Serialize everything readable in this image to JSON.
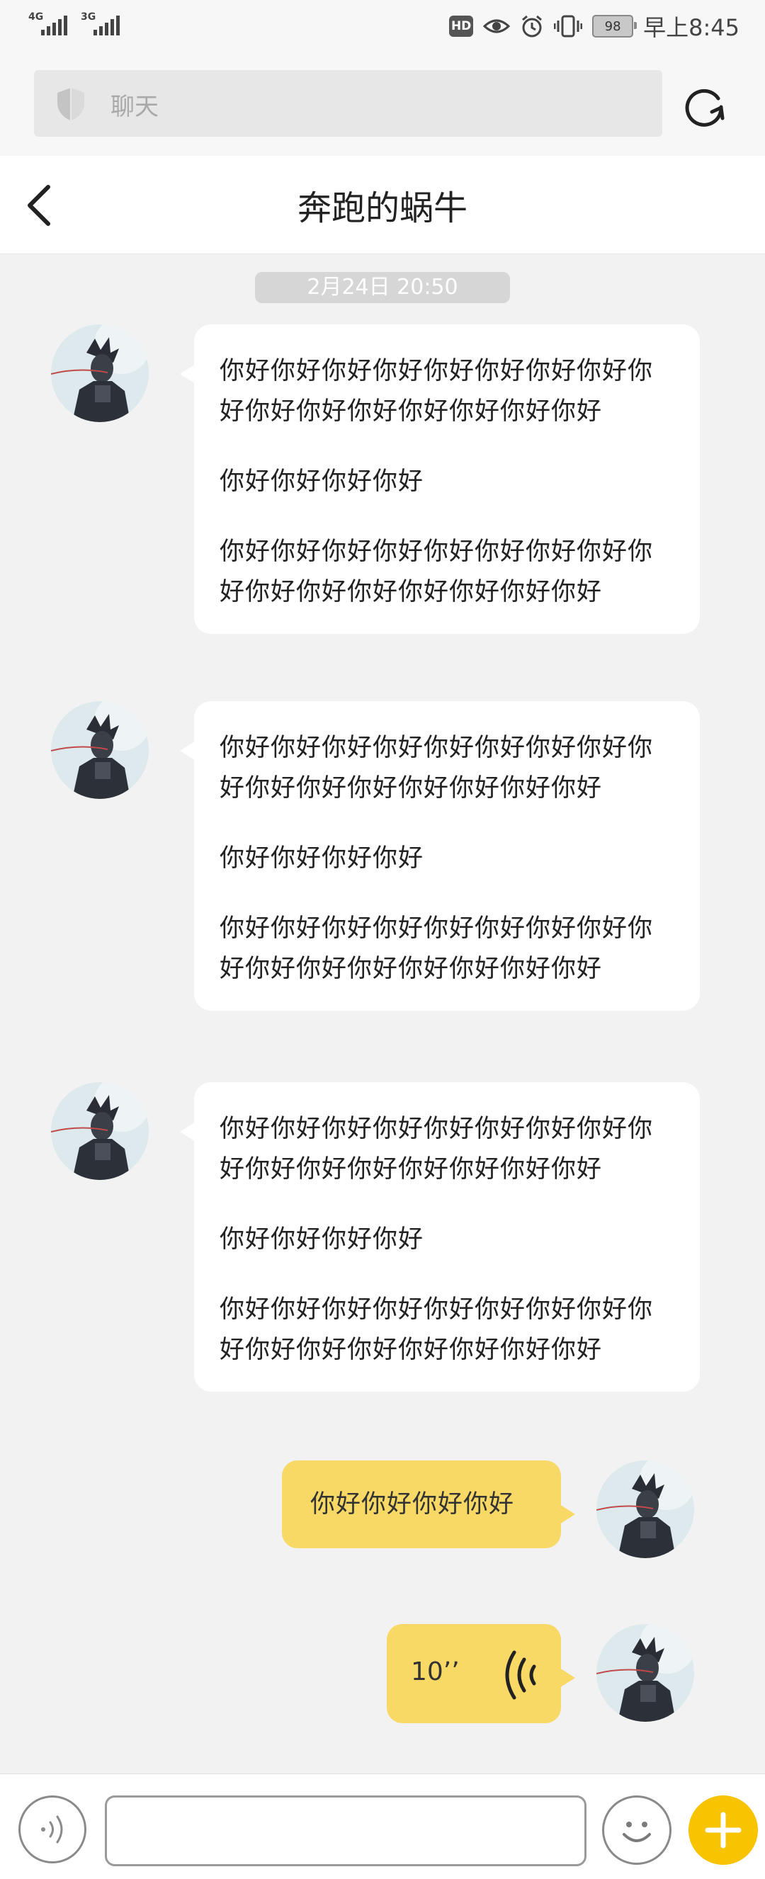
{
  "status_bar": {
    "signal_1_label": "4G",
    "signal_2_label": "3G",
    "hd_label": "HD",
    "battery_level": "98",
    "time": "早上8:45"
  },
  "search": {
    "placeholder": "聊天"
  },
  "header": {
    "title": "奔跑的蜗牛"
  },
  "chat": {
    "timestamp": "2月24日 20:50",
    "incoming": [
      {
        "paragraphs": [
          "你好你好你好你好你好你好你好你好你好你好你好你好你好你好你好你好",
          "你好你好你好你好",
          "你好你好你好你好你好你好你好你好你好你好你好你好你好你好你好你好"
        ]
      },
      {
        "paragraphs": [
          "你好你好你好你好你好你好你好你好你好你好你好你好你好你好你好你好",
          "你好你好你好你好",
          "你好你好你好你好你好你好你好你好你好你好你好你好你好你好你好你好"
        ]
      },
      {
        "paragraphs": [
          "你好你好你好你好你好你好你好你好你好你好你好你好你好你好你好你好",
          "你好你好你好你好",
          "你好你好你好你好你好你好你好你好你好你好你好你好你好你好你好你好"
        ]
      }
    ],
    "outgoing_text": "你好你好你好你好",
    "outgoing_voice_duration": "10’’"
  },
  "colors": {
    "background": "#f2f2f2",
    "incoming_bubble": "#ffffff",
    "outgoing_bubble": "#f8d966",
    "accent": "#f8c300"
  }
}
